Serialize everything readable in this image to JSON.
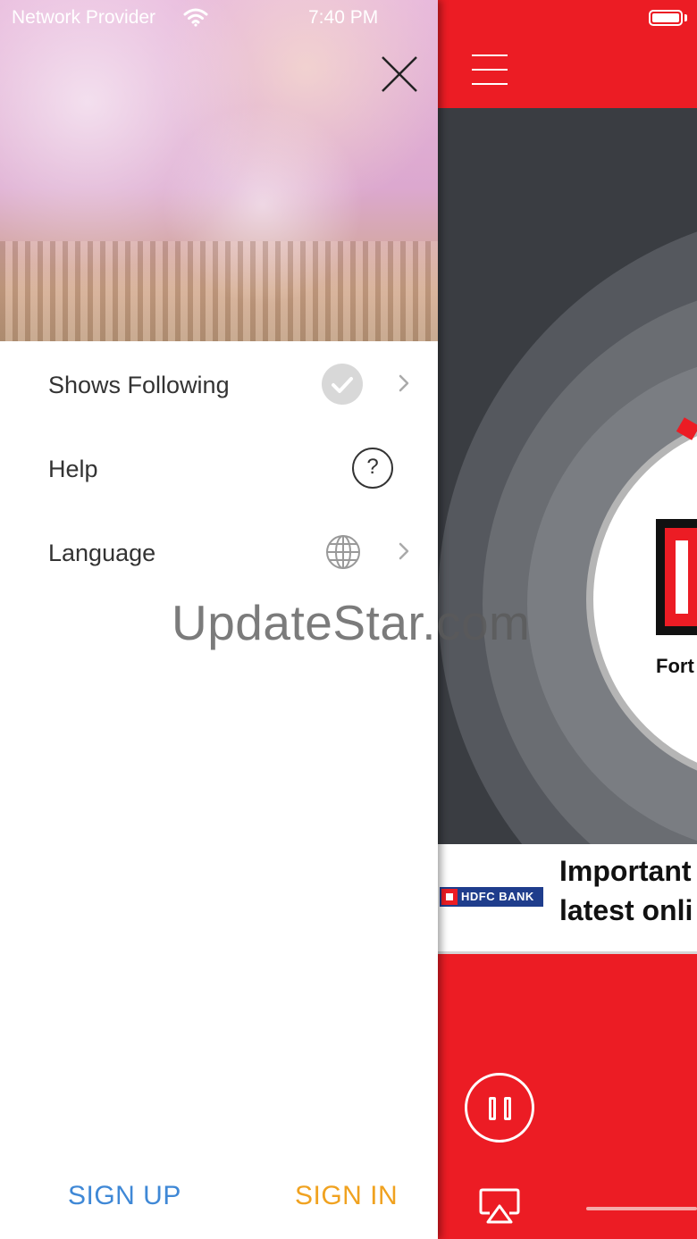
{
  "status_bar": {
    "carrier": "Network Provider",
    "time": "7:40 PM",
    "wifi_icon": "wifi-icon",
    "battery_icon": "battery-icon"
  },
  "drawer": {
    "close_icon": "close-icon",
    "menu": [
      {
        "label": "Shows Following",
        "icon": "checkmark-circle-icon",
        "chevron": true
      },
      {
        "label": "Help",
        "icon": "question-circle-icon",
        "chevron": false
      },
      {
        "label": "Language",
        "icon": "globe-icon",
        "chevron": true
      }
    ],
    "sign_up": "SIGN UP",
    "sign_in": "SIGN IN"
  },
  "watermark": "UpdateStar.com",
  "app": {
    "menu_icon": "hamburger-icon",
    "station_name": "Fort",
    "ad": {
      "brand": "HDFC BANK",
      "line1": "Important",
      "line2": "latest onli"
    },
    "controls": {
      "pause_icon": "pause-icon",
      "airplay_icon": "airplay-icon"
    }
  },
  "colors": {
    "accent": "#ec1c24",
    "sign_up": "#3f88d6",
    "sign_in": "#f0a220"
  }
}
